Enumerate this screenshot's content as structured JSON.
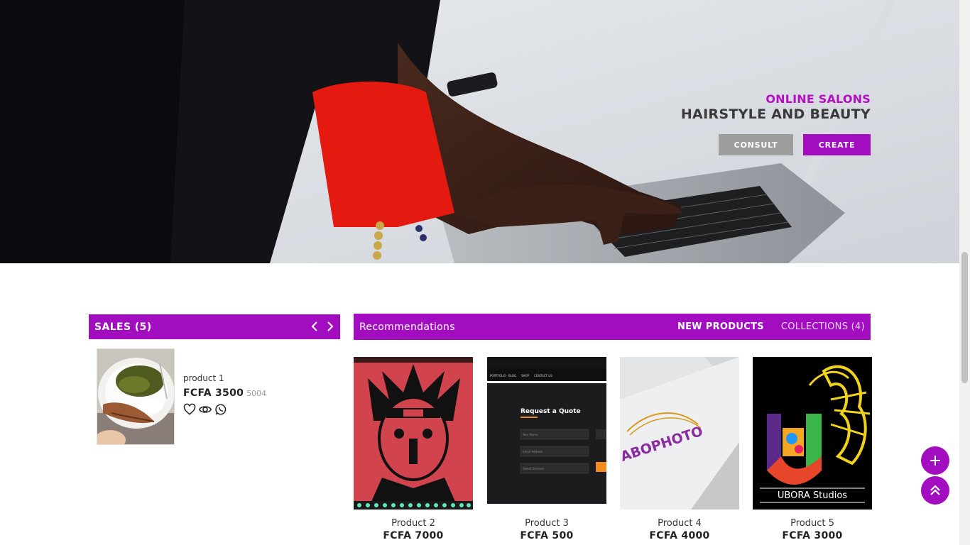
{
  "hero": {
    "subtitle": "ONLINE SALONS",
    "title": "HAIRSTYLE AND BEAUTY",
    "consult_label": "CONSULT",
    "create_label": "CREATE",
    "image_icon": "woman-typing-on-laptop-photo"
  },
  "sales": {
    "header": "SALES (5)",
    "prev_icon": "chevron-left-icon",
    "next_icon": "chevron-right-icon",
    "item": {
      "name": "product 1",
      "price": "FCFA 3500",
      "old_price": "5004",
      "image_icon": "fish-and-greens-plate-photo",
      "actions": [
        "heart-icon",
        "eye-icon",
        "whatsapp-icon"
      ]
    }
  },
  "recommendations": {
    "header": "Recommendations",
    "tabs": [
      {
        "label": "NEW PRODUCTS",
        "active": true
      },
      {
        "label": "COLLECTIONS (4)",
        "active": false
      }
    ],
    "products": [
      {
        "name": "Product 2",
        "price": "FCFA 7000",
        "image_icon": "anime-character-poster"
      },
      {
        "name": "Product 3",
        "price": "FCFA 500",
        "image_icon": "website-quote-form-screenshot",
        "image_text": {
          "nav": [
            "PORTFOLIO",
            "BLOG",
            "SHOP",
            "CONTACT US"
          ],
          "heading": "Request a Quote",
          "fields": [
            "Your Name",
            "Email Address",
            "Select Services"
          ]
        }
      },
      {
        "name": "Product 4",
        "price": "FCFA 4000",
        "image_icon": "abophoto-logo-mockup",
        "image_text": "ABOPHOTO"
      },
      {
        "name": "Product 5",
        "price": "FCFA 3000",
        "image_icon": "ubora-studios-logo",
        "image_text": "UBORA Studios"
      }
    ]
  },
  "fabs": {
    "add_icon": "plus-icon",
    "top_icon": "double-chevron-up-icon"
  },
  "colors": {
    "accent": "#a30dc0",
    "subtitle": "#b30ec4",
    "consult": "#9e9e9e"
  }
}
